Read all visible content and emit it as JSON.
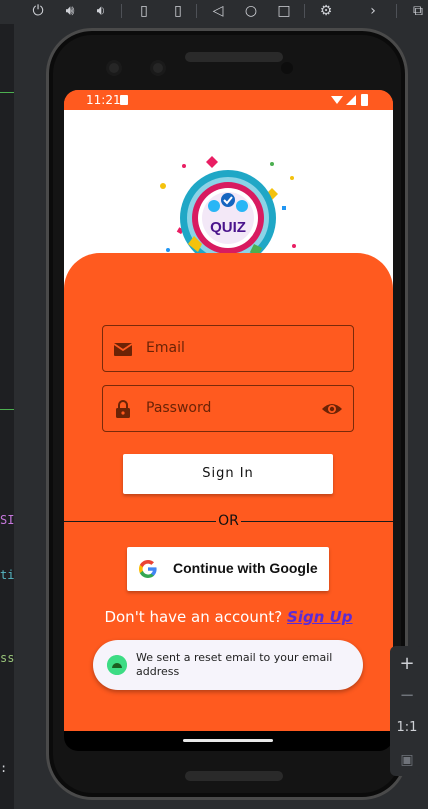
{
  "ide": {
    "toolbar_icons": [
      "power-icon",
      "volume-up-icon",
      "volume-down-icon",
      "rotate-left-icon",
      "rotate-right-icon",
      "back-icon",
      "home-icon",
      "overview-icon",
      "settings-icon",
      "more-icon",
      "screenshot-icon"
    ],
    "strip_marks": [
      "SI",
      "ti",
      "ss",
      ":"
    ],
    "side_controls": {
      "zoom_in": "+",
      "zoom_out": "−",
      "ratio": "1:1"
    }
  },
  "status_bar": {
    "time": "11:21"
  },
  "app": {
    "logo_text": "QUIZ",
    "email": {
      "placeholder": "Email"
    },
    "password": {
      "placeholder": "Password"
    },
    "sign_in_label": "Sign In",
    "divider_text": "OR",
    "google_label": "Continue with Google",
    "signup_prompt": "Don't have an account?",
    "signup_link": "Sign Up",
    "toast": "We sent a reset email to your email address"
  },
  "colors": {
    "primary": "#ff5a1f",
    "link": "#5b2bd6"
  }
}
